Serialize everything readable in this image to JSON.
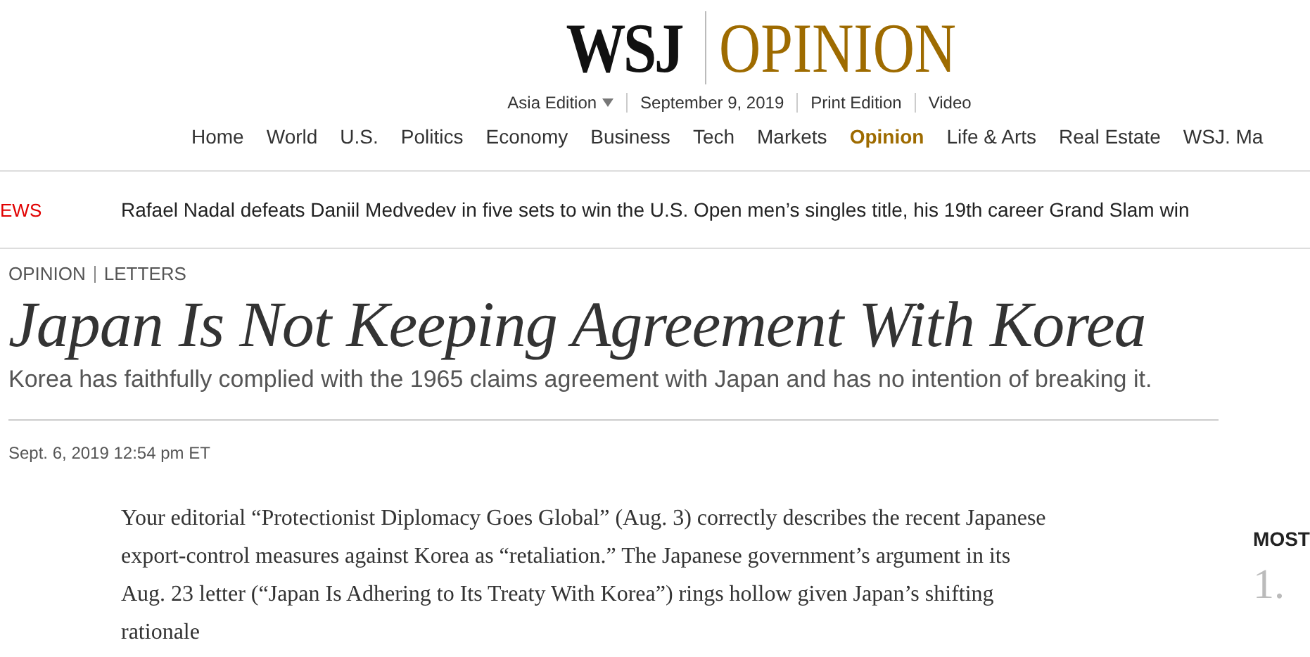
{
  "masthead": {
    "brand": "WSJ",
    "section": "OPINION"
  },
  "edition_bar": [
    {
      "label": "Asia Edition",
      "kind": "dropdown"
    },
    {
      "label": "September 9, 2019",
      "kind": "text"
    },
    {
      "label": "Print Edition",
      "kind": "link"
    },
    {
      "label": "Video",
      "kind": "link"
    }
  ],
  "nav": [
    {
      "label": "Home",
      "selected": false
    },
    {
      "label": "World",
      "selected": false
    },
    {
      "label": "U.S.",
      "selected": false
    },
    {
      "label": "Politics",
      "selected": false
    },
    {
      "label": "Economy",
      "selected": false
    },
    {
      "label": "Business",
      "selected": false
    },
    {
      "label": "Tech",
      "selected": false
    },
    {
      "label": "Markets",
      "selected": false
    },
    {
      "label": "Opinion",
      "selected": true
    },
    {
      "label": "Life & Arts",
      "selected": false
    },
    {
      "label": "Real Estate",
      "selected": false
    },
    {
      "label": "WSJ. Ma",
      "selected": false
    }
  ],
  "news_ticker": {
    "label": "EWS",
    "headline": "Rafael Nadal defeats Daniil Medvedev in five sets to win the U.S. Open men’s singles title, his 19th career Grand Slam win"
  },
  "article": {
    "breadcrumb": [
      "OPINION",
      "LETTERS"
    ],
    "title": "Japan Is Not Keeping Agreement With Korea",
    "subtitle": "Korea has faithfully complied with the 1965 claims agreement with Japan and has no intention of breaking it.",
    "timestamp": "Sept. 6, 2019 12:54 pm ET",
    "body": "Your editorial “Protectionist Diplomacy Goes Global” (Aug. 3) correctly describes the recent Japanese export-control measures against Korea as “retaliation.” The Japanese government’s argument in its Aug. 23 letter (“Japan Is Adhering to Its Treaty With Korea”) rings hollow given Japan’s shifting rationale"
  },
  "sidebar": {
    "heading": "MOST",
    "rank": "1."
  }
}
